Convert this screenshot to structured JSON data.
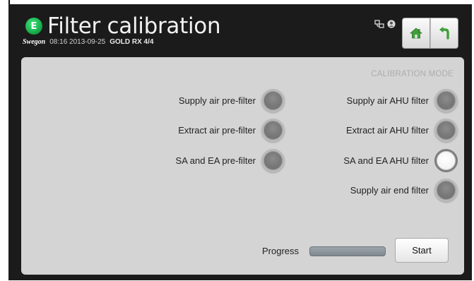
{
  "header": {
    "logo_letter": "E",
    "title": "Filter calibration",
    "brand": "Swegon",
    "time": "08:16",
    "date": "2013-09-25",
    "model": "GOLD RX",
    "page": "4/4"
  },
  "panel": {
    "mode_label": "CALIBRATION MODE",
    "left_filters": [
      {
        "label": "Supply air pre-filter",
        "selected": false
      },
      {
        "label": "Extract air pre-filter",
        "selected": false
      },
      {
        "label": "SA and EA pre-filter",
        "selected": false
      }
    ],
    "right_filters": [
      {
        "label": "Supply air AHU filter",
        "selected": false
      },
      {
        "label": "Extract air AHU filter",
        "selected": false
      },
      {
        "label": "SA and EA AHU filter",
        "selected": true
      },
      {
        "label": "Supply air end filter",
        "selected": false
      }
    ],
    "progress_label": "Progress",
    "progress_value": 0,
    "start_label": "Start"
  },
  "colors": {
    "logo_green": "#1bb34f",
    "home_icon": "#3f9e3a",
    "back_icon": "#3f9e3a"
  }
}
